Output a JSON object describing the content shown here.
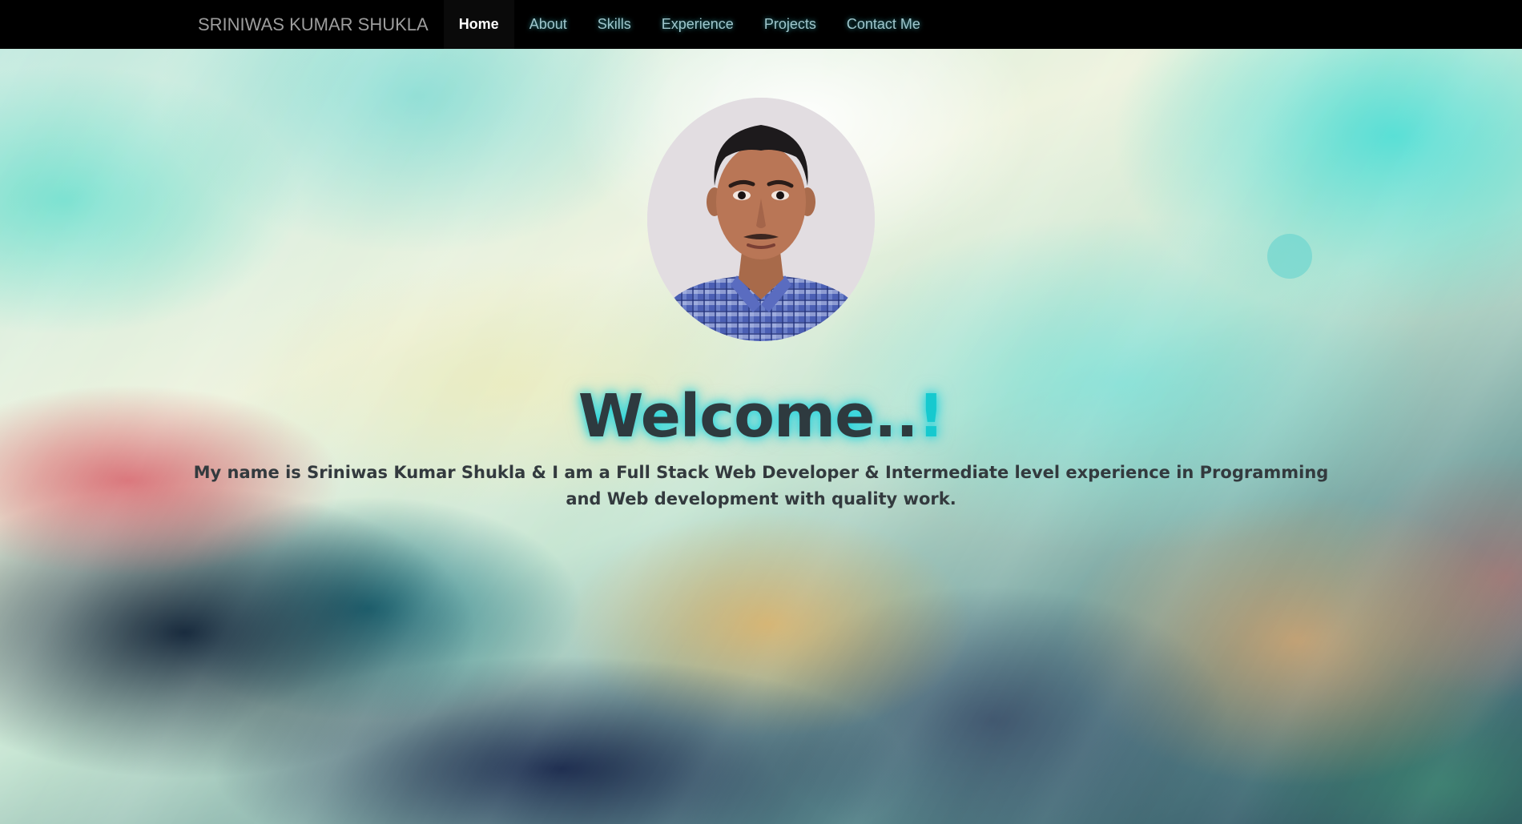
{
  "navbar": {
    "brand": "SRINIWAS KUMAR SHUKLA",
    "items": [
      {
        "label": "Home",
        "active": true
      },
      {
        "label": "About",
        "active": false
      },
      {
        "label": "Skills",
        "active": false
      },
      {
        "label": "Experience",
        "active": false
      },
      {
        "label": "Projects",
        "active": false
      },
      {
        "label": "Contact Me",
        "active": false
      }
    ]
  },
  "hero": {
    "welcome_text": "Welcome..",
    "welcome_mark": "!",
    "intro": "My name is Sriniwas Kumar Shukla & I am a Full Stack Web Developer & Intermediate level experience in Programming and Web development with quality work."
  },
  "colors": {
    "navbar_bg": "#000000",
    "nav_link": "#9fc6cc",
    "accent": "#16c9cf",
    "heading": "#2e3a3f"
  }
}
